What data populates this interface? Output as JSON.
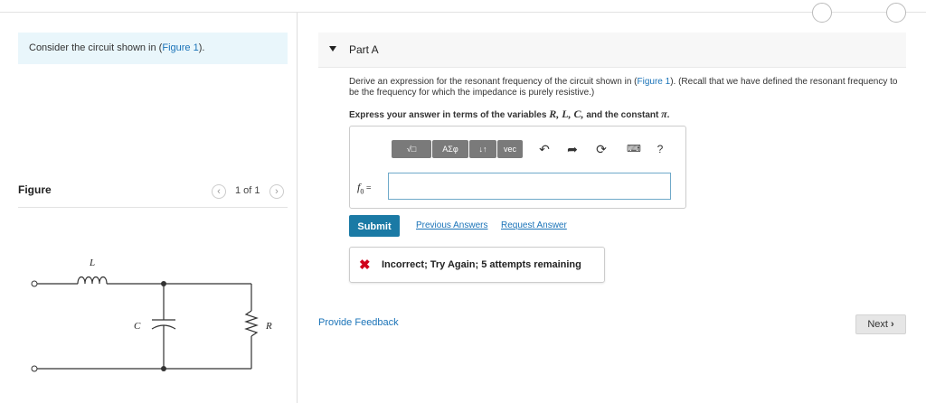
{
  "left": {
    "consider_prefix": "Consider the circuit shown in (",
    "consider_link": "Figure 1",
    "consider_suffix": ").",
    "figure_title": "Figure",
    "pager": "1 of 1",
    "prev_icon": "chevron-left-icon",
    "next_icon": "chevron-right-icon",
    "circuit": {
      "inductor_label": "L",
      "capacitor_label": "C",
      "resistor_label": "R"
    }
  },
  "part": {
    "title": "Part A",
    "question_prefix": "Derive an expression for the resonant frequency of the circuit shown in (",
    "question_link": "Figure 1",
    "question_suffix": "). (Recall that we have defined the resonant frequency to be the frequency for which the impedance is purely resistive.)",
    "express_prefix": "Express your answer in terms of the variables ",
    "express_vars": "R, L, C,",
    "express_mid": " and the constant ",
    "express_const": "π",
    "express_end": ".",
    "toolbar": {
      "templates_label": "√□",
      "symbols_label": "ΑΣφ",
      "arrows_label": "↓↑",
      "vec_label": "vec",
      "undo_icon": "undo-icon",
      "redo_icon": "redo-icon",
      "reset_icon": "reset-icon",
      "keyboard_icon": "keyboard-icon",
      "help_label": "?"
    },
    "answer_label": "f",
    "answer_sub": "0",
    "answer_eq": " =",
    "answer_value": "",
    "submit_label": "Submit",
    "previous_answers": "Previous Answers",
    "request_answer": "Request Answer",
    "feedback_text": "Incorrect; Try Again; 5 attempts remaining",
    "feedback_color": "#d0021b"
  },
  "footer": {
    "provide_feedback": "Provide Feedback",
    "next_label": "Next",
    "next_icon": "chevron-right-icon"
  }
}
